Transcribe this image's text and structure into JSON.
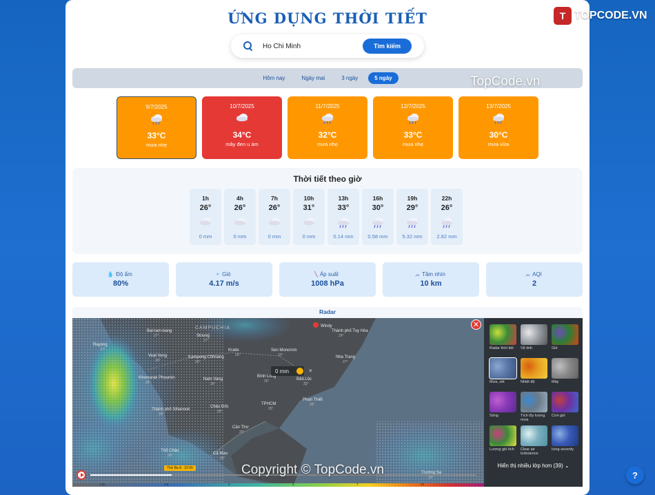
{
  "brand": {
    "logo_text": "TOPCODE.VN",
    "watermark": "TopCode.vn",
    "copyright": "Copyright © TopCode.vn"
  },
  "title": "ỨNG DỤNG THỜI TIẾT",
  "search": {
    "value": "Ho Chi Minh",
    "button": "Tìm kiếm"
  },
  "tabs": [
    {
      "label": "Hôm nay",
      "active": false
    },
    {
      "label": "Ngày mai",
      "active": false
    },
    {
      "label": "3 ngày",
      "active": false
    },
    {
      "label": "5 ngày",
      "active": true
    }
  ],
  "days": [
    {
      "date": "9/7/2025",
      "temp": "33°C",
      "desc": "mưa nhẹ",
      "icon": "rain-cloud-icon",
      "color": "#ff9800",
      "selected": true
    },
    {
      "date": "10/7/2025",
      "temp": "34°C",
      "desc": "mây đen u ám",
      "icon": "cloud-icon",
      "color": "#e53935",
      "selected": false
    },
    {
      "date": "11/7/2025",
      "temp": "32°C",
      "desc": "mưa nhẹ",
      "icon": "rain-cloud-icon",
      "color": "#ff9800",
      "selected": false
    },
    {
      "date": "12/7/2025",
      "temp": "33°C",
      "desc": "mưa nhẹ",
      "icon": "rain-cloud-icon",
      "color": "#ff9800",
      "selected": false
    },
    {
      "date": "13/7/2025",
      "temp": "30°C",
      "desc": "mưa vừa",
      "icon": "rain-cloud-icon",
      "color": "#ff9800",
      "selected": false
    }
  ],
  "hourly": {
    "heading": "Thời tiết theo giờ",
    "items": [
      {
        "hour": "1h",
        "temp": "26°",
        "rain": "0 mm",
        "icon": "cloud-icon"
      },
      {
        "hour": "4h",
        "temp": "26°",
        "rain": "0 mm",
        "icon": "cloud-icon"
      },
      {
        "hour": "7h",
        "temp": "26°",
        "rain": "0 mm",
        "icon": "cloud-icon"
      },
      {
        "hour": "10h",
        "temp": "31°",
        "rain": "0 mm",
        "icon": "cloud-icon"
      },
      {
        "hour": "13h",
        "temp": "33°",
        "rain": "0.14 mm",
        "icon": "rain-cloud-icon"
      },
      {
        "hour": "16h",
        "temp": "30°",
        "rain": "0.58 mm",
        "icon": "rain-cloud-icon"
      },
      {
        "hour": "19h",
        "temp": "29°",
        "rain": "5.32 mm",
        "icon": "rain-cloud-icon"
      },
      {
        "hour": "22h",
        "temp": "26°",
        "rain": "2.82 mm",
        "icon": "rain-cloud-icon"
      }
    ]
  },
  "stats": [
    {
      "label": "Độ ẩm",
      "value": "80%",
      "icon": "droplet-icon"
    },
    {
      "label": "Gió",
      "value": "4.17 m/s",
      "icon": "wind-icon"
    },
    {
      "label": "Áp suất",
      "value": "1008 hPa",
      "icon": "thermometer-icon"
    },
    {
      "label": "Tầm nhìn",
      "value": "10 km",
      "icon": "fog-icon"
    },
    {
      "label": "AQI",
      "value": "2",
      "icon": "cloud-icon"
    }
  ],
  "radar": {
    "heading": "Radar",
    "provider": "Windy",
    "popup": "0 mm",
    "timeline_label": "Thứ Ba 8 - 22:00",
    "places": [
      {
        "name": "CAMPUCHIA",
        "temp": ""
      },
      {
        "name": "Bat-tam-bang",
        "temp": "27°"
      },
      {
        "name": "Stoung",
        "temp": "27°"
      },
      {
        "name": "Rayong",
        "temp": "27°"
      },
      {
        "name": "Veal Veng",
        "temp": "25°"
      },
      {
        "name": "Kampong Chhnang",
        "temp": "26°"
      },
      {
        "name": "Kratie",
        "temp": "26°"
      },
      {
        "name": "Sen Monorom",
        "temp": "22°"
      },
      {
        "name": "Thành phố Tuy Hòa",
        "temp": "29°"
      },
      {
        "name": "Nha Trang",
        "temp": "27°"
      },
      {
        "name": "Khemarak Phoumin",
        "temp": "25°"
      },
      {
        "name": "Nam Vang",
        "temp": "26°"
      },
      {
        "name": "Bình Long",
        "temp": "25°"
      },
      {
        "name": "Bảo Lộc",
        "temp": "23°"
      },
      {
        "name": "Phan Thiết",
        "temp": "28°"
      },
      {
        "name": "TPHCM",
        "temp": "25°"
      },
      {
        "name": "Thành phố Sihanouk",
        "temp": "28°"
      },
      {
        "name": "Châu Đốc",
        "temp": "25°"
      },
      {
        "name": "Cần Thơ",
        "temp": "25°"
      },
      {
        "name": "Thổ Châu",
        "temp": "28°"
      },
      {
        "name": "Cà Mau",
        "temp": "25°"
      },
      {
        "name": "Trường Sa",
        "temp": "29°"
      }
    ],
    "scale_labels": [
      "mm",
      "1.5",
      "2",
      "3",
      "7",
      "10"
    ],
    "layers": [
      {
        "name": "Radar thời tiết",
        "colors": [
          "#3a8a3a",
          "#c8e03a",
          "#d04040"
        ],
        "selected": false
      },
      {
        "name": "Vệ tinh",
        "colors": [
          "#9aa0a6",
          "#e8e8e8",
          "#555"
        ],
        "selected": false
      },
      {
        "name": "Gió",
        "colors": [
          "#2e7d32",
          "#6a4fb8",
          "#d84315"
        ],
        "selected": false
      },
      {
        "name": "Mưa, sét",
        "colors": [
          "#5a78a8",
          "#8aa8d0",
          "#3a5078"
        ],
        "selected": true
      },
      {
        "name": "Nhiệt độ",
        "colors": [
          "#e8a020",
          "#d86010",
          "#f0d040"
        ],
        "selected": false
      },
      {
        "name": "Mây",
        "colors": [
          "#8a8a8a",
          "#c0c0c0",
          "#606060"
        ],
        "selected": false
      },
      {
        "name": "Sóng",
        "colors": [
          "#8a3ab8",
          "#c060d0",
          "#5a2a90"
        ],
        "selected": false
      },
      {
        "name": "Tích lũy lượng mưa",
        "colors": [
          "#6a7a8a",
          "#3a8ad0",
          "#9ab0c0"
        ],
        "selected": false
      },
      {
        "name": "Cơn gió",
        "colors": [
          "#7030a0",
          "#c04040",
          "#3a6ad0"
        ],
        "selected": false
      },
      {
        "name": "Lượng gió tích",
        "colors": [
          "#3a8a3a",
          "#c84080",
          "#e0e040"
        ],
        "selected": false
      },
      {
        "name": "Clear air turbulence",
        "colors": [
          "#7ab0c0",
          "#e0f0f0",
          "#5090a0"
        ],
        "selected": false
      },
      {
        "name": "Icing severity",
        "colors": [
          "#3a5ab8",
          "#8ab0e0",
          "#1a3a80"
        ],
        "selected": false
      }
    ],
    "more_layers": "Hiển thị nhiều lớp hơn (39)"
  }
}
